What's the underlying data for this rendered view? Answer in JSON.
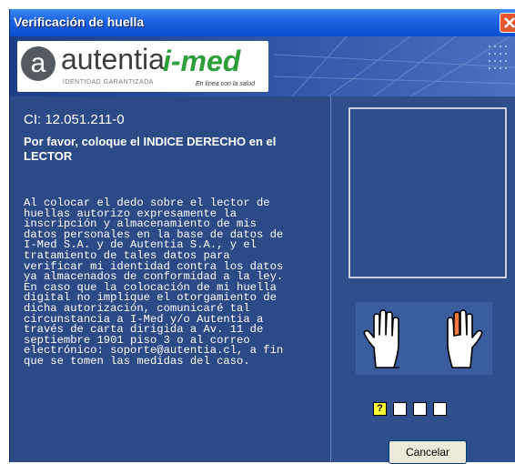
{
  "window": {
    "title": "Verificación de huella"
  },
  "banner": {
    "autentia_logo_text": "autentia",
    "autentia_tagline": "IDENTIDAD GARANTIZADA",
    "imed_logo_text": "i-med",
    "imed_tagline": "En línea con la salud"
  },
  "main": {
    "ci": "CI: 12.051.211-0",
    "instruction": "Por favor, coloque el INDICE DERECHO en el LECTOR",
    "consent_text": "Al colocar el dedo sobre el lector de\nhuellas autorizo expresamente la\ninscripción y almacenamiento de mis\ndatos personales en la base de datos de\nI-Med S.A. y de Autentia S.A., y el\ntratamiento de tales datos para\nverificar mi identidad contra los datos\nya almacenados de conformidad a la ley.\nEn caso que la colocación de mi huella\ndigital no implique el otorgamiento de\ndicha autorización, comunicaré tal\ncircunstancia a I-Med y/o Autentia a\ntravés de carta dirigida a Av. 11 de\nseptiembre 1901 piso 3 o al correo\nelectrónico: soporte@autentia.cl, a fin\nque se tomen las medidas del caso."
  },
  "fingers": {
    "left_hand_icon": "left-hand-icon",
    "right_hand_icon": "right-hand-icon",
    "highlight_color": "#f07840"
  },
  "steps": [
    {
      "label": "?",
      "active": true
    },
    {
      "label": "",
      "active": false
    },
    {
      "label": "",
      "active": false
    },
    {
      "label": "",
      "active": false
    }
  ],
  "actions": {
    "cancel_label": "Cancelar"
  },
  "colors": {
    "panel_bg": "#2c4a86",
    "titlebar": "#1f63e0",
    "imed_green": "#2c9e3a"
  }
}
